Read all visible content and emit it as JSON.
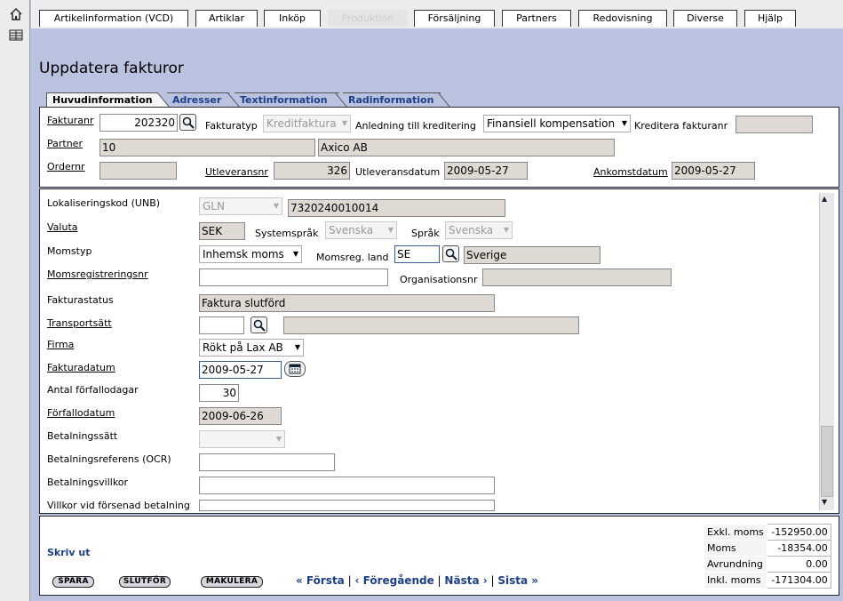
{
  "nav": {
    "tabs": [
      "Artikelinformation (VCD)",
      "Artiklar",
      "Inköp",
      "Produktion",
      "Försäljning",
      "Partners",
      "Redovisning",
      "Diverse",
      "Hjälp"
    ]
  },
  "page": {
    "title": "Uppdatera fakturor"
  },
  "subtabs": [
    "Huvudinformation",
    "Adresser",
    "Textinformation",
    "Radinformation"
  ],
  "header": {
    "fakturanr_label": "Fakturanr",
    "fakturanr": "202320",
    "fakturatyp_label": "Fakturatyp",
    "fakturatyp": "Kreditfaktura",
    "anledning_label": "Anledning till kreditering",
    "anledning": "Finansiell kompensation",
    "kreditera_label": "Kreditera fakturanr",
    "kreditera": "",
    "partner_label": "Partner",
    "partner_id": "10",
    "partner_name": "Axico AB",
    "ordernr_label": "Ordernr",
    "ordernr": "",
    "utleveransnr_label": "Utleveransnr",
    "utleveransnr": "326",
    "utleveransdatum_label": "Utleveransdatum",
    "utleveransdatum": "2009-05-27",
    "ankomstdatum_label": "Ankomstdatum",
    "ankomstdatum": "2009-05-27"
  },
  "details": {
    "lokalisering_label": "Lokaliseringskod (UNB)",
    "lokalisering_type": "GLN",
    "lokalisering_code": "7320240010014",
    "valuta_label": "Valuta",
    "valuta": "SEK",
    "systemsprak_label": "Systemspråk",
    "systemsprak": "Svenska",
    "sprak_label": "Språk",
    "sprak": "Svenska",
    "momstyp_label": "Momstyp",
    "momstyp": "Inhemsk moms",
    "momsreg_land_label": "Momsreg. land",
    "momsreg_land": "SE",
    "momsreg_land_name": "Sverige",
    "momsregnr_label": "Momsregistreringsnr",
    "momsregnr": "",
    "orgnr_label": "Organisationsnr",
    "orgnr": "",
    "fakturastatus_label": "Fakturastatus",
    "fakturastatus": "Faktura slutförd",
    "transportsatt_label": "Transportsätt",
    "transportsatt": "",
    "transportsatt_desc": "",
    "firma_label": "Firma",
    "firma": "Rökt på Lax AB",
    "fakturadatum_label": "Fakturadatum",
    "fakturadatum": "2009-05-27",
    "forfallodagar_label": "Antal förfallodagar",
    "forfallodagar": "30",
    "forfallodatum_label": "Förfallodatum",
    "forfallodatum": "2009-06-26",
    "betalningssatt_label": "Betalningssätt",
    "betalningssatt": "",
    "ocr_label": "Betalningsreferens (OCR)",
    "ocr": "",
    "villkor_label": "Betalningsvillkor",
    "villkor": "",
    "forsenad_label": "Villkor vid försenad betalning",
    "forsenad": ""
  },
  "footer": {
    "print_label": "Skriv ut",
    "buttons": [
      "SPARA",
      "SLUTFÖR",
      "MAKULERA"
    ],
    "pager": {
      "first": "« Första",
      "prev": "‹ Föregående",
      "next": "Nästa ›",
      "last": "Sista »",
      "sep": "|"
    },
    "summary": [
      {
        "label": "Exkl. moms",
        "value": "-152950.00"
      },
      {
        "label": "Moms",
        "value": "-18354.00"
      },
      {
        "label": "Avrundning",
        "value": "0.00"
      },
      {
        "label": "Inkl. moms",
        "value": "-171304.00"
      }
    ]
  },
  "icons": {
    "home": "home-icon",
    "menu": "menu-icon",
    "search": "magnifier-icon",
    "calendar": "calendar-icon"
  },
  "colors": {
    "background": "#b9c2df",
    "link": "#1d3f86",
    "readonly": "#dedad3"
  }
}
